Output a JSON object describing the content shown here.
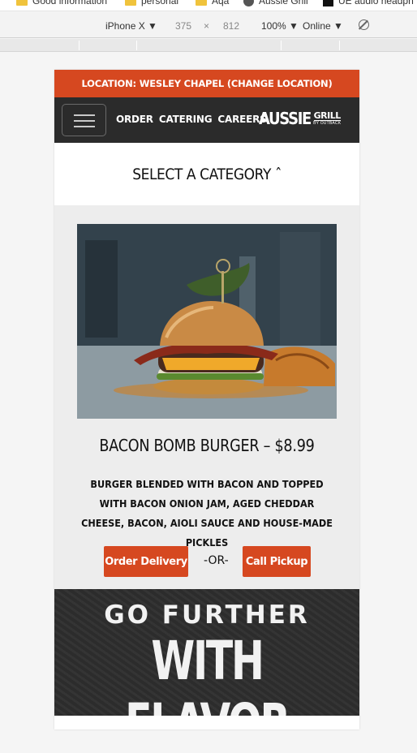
{
  "bookmarks": [
    {
      "label": "Good information",
      "icon": "folder-icon"
    },
    {
      "label": "personal",
      "icon": "folder-icon"
    },
    {
      "label": "Aqa",
      "icon": "folder-icon"
    },
    {
      "label": "Aussie Grill",
      "icon": "globe-icon"
    },
    {
      "label": "UE audio headph",
      "icon": "square-icon"
    }
  ],
  "devtools": {
    "device": "iPhone X",
    "width": "375",
    "times": "×",
    "height": "812",
    "zoom": "100%",
    "network": "Online",
    "caret": "▼"
  },
  "site": {
    "location_text": "LOCATION: WESLEY CHAPEL (CHANGE LOCATION)",
    "nav": [
      "ORDER",
      "CATERING",
      "CAREERS"
    ],
    "logo": {
      "main": "AUSSIE",
      "side": "GRILL",
      "sub": "BY OUTBACK"
    },
    "category_label": "SELECT A CATEGORY ˆ",
    "item": {
      "title": "BACON BOMB BURGER – $8.99",
      "description": "BURGER BLENDED WITH BACON AND TOPPED WITH BACON ONION JAM, AGED CHEDDAR CHEESE, BACON, AIOLI SAUCE AND HOUSE-MADE PICKLES",
      "delivery_label": "Order Delivery",
      "or_label": "-OR-",
      "pickup_label": "Call Pickup"
    },
    "banner": {
      "line1": "GO FURTHER",
      "line2": "WITH FLAVOR"
    }
  },
  "colors": {
    "brand_orange": "#d64820",
    "nav_dark": "#2b2b2b",
    "item_bg": "#ededed"
  }
}
